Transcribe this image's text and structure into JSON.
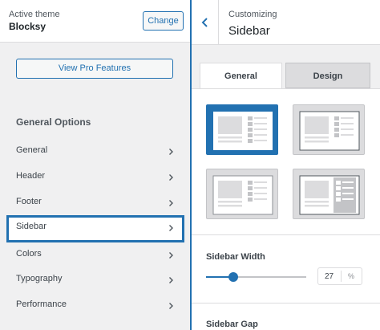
{
  "left_panel": {
    "header": {
      "active_theme_label": "Active theme",
      "theme_name": "Blocksy",
      "change_label": "Change"
    },
    "pro_button_label": "View Pro Features",
    "section_title": "General Options",
    "menu_items": [
      {
        "label": "General"
      },
      {
        "label": "Header"
      },
      {
        "label": "Footer"
      },
      {
        "label": "Sidebar"
      },
      {
        "label": "Colors"
      },
      {
        "label": "Typography"
      },
      {
        "label": "Performance"
      }
    ],
    "active_item": "Sidebar"
  },
  "right_panel": {
    "header": {
      "customizing_label": "Customizing",
      "title": "Sidebar"
    },
    "tabs": [
      {
        "label": "General",
        "active": true
      },
      {
        "label": "Design",
        "active": false
      }
    ],
    "layouts": [
      {
        "name": "right-sidebar",
        "selected": true
      },
      {
        "name": "right-sidebar-bordered",
        "selected": false
      },
      {
        "name": "left-sidebar",
        "selected": false
      },
      {
        "name": "right-sidebar-boxed",
        "selected": false
      }
    ],
    "sidebar_width": {
      "label": "Sidebar Width",
      "value": "27",
      "unit": "%",
      "slider_fraction": 0.27
    },
    "sidebar_gap": {
      "label": "Sidebar Gap"
    }
  },
  "colors": {
    "accent": "#2271b1",
    "panel_bg": "#f0f0f1",
    "white": "#ffffff"
  },
  "icons": {
    "back": "chevron-left-icon",
    "menu_chevron": "chevron-right-icon"
  }
}
